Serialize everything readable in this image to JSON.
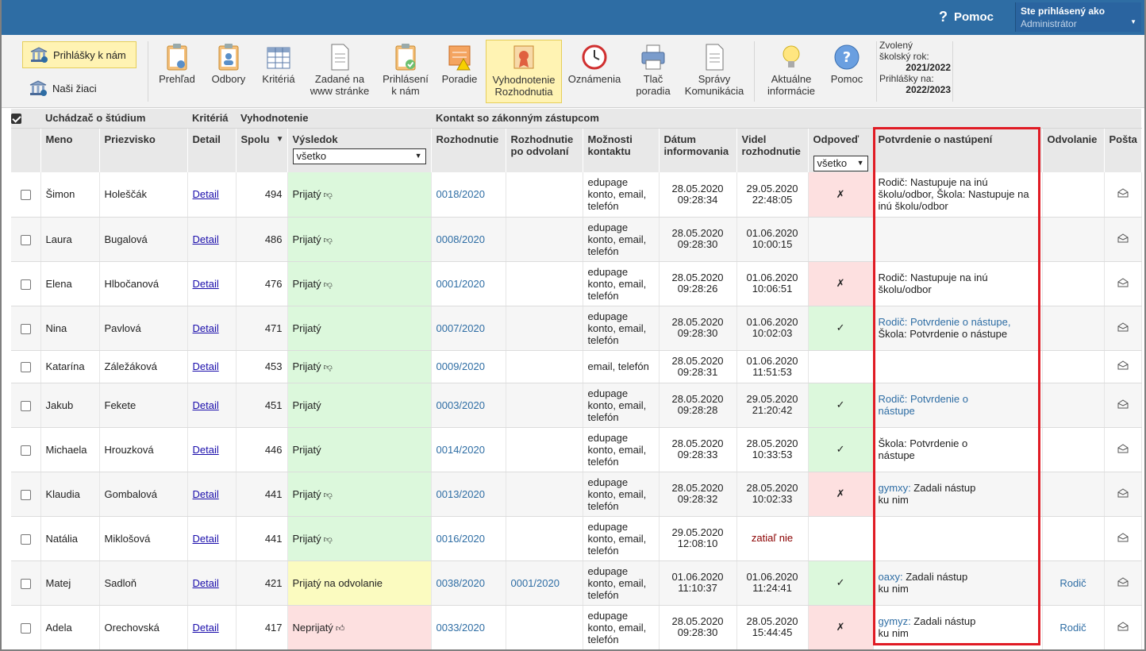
{
  "topbar": {
    "help_label": "Pomoc",
    "user_line1": "Ste prihlásený ako",
    "user_line2": "Administrátor"
  },
  "toolbar": {
    "left_buttons": [
      {
        "label": "Prihlášky k nám",
        "icon": "bank-icon"
      },
      {
        "label": "Naši žiaci",
        "icon": "bank-icon"
      }
    ],
    "buttons": [
      {
        "label": "Prehľad",
        "icon": "clipboard-eye-icon"
      },
      {
        "label": "Odbory",
        "icon": "clipboard-person-icon"
      },
      {
        "label": "Kritériá",
        "icon": "table-icon"
      },
      {
        "label": "Zadané na\nwww stránke",
        "icon": "document-icon"
      },
      {
        "label": "Prihlásení\nk nám",
        "icon": "clipboard-check-icon"
      },
      {
        "label": "Poradie",
        "icon": "warning-document-icon"
      },
      {
        "label": "Vyhodnotenie\nRozhodnutia",
        "icon": "certificate-icon"
      },
      {
        "label": "Oznámenia",
        "icon": "clock-icon"
      },
      {
        "label": "Tlač\nporadia",
        "icon": "printer-icon"
      },
      {
        "label": "Správy\nKomunikácia",
        "icon": "document-icon"
      },
      {
        "label": "Aktuálne\ninformácie",
        "icon": "lightbulb-icon"
      },
      {
        "label": "Pomoc",
        "icon": "help-circle-icon"
      }
    ],
    "year": {
      "label1": "Zvolený\nškolský rok:",
      "value1": "2021/2022",
      "label2": "Prihlášky na:",
      "value2": "2022/2023"
    }
  },
  "table": {
    "groups": {
      "student": "Uchádzač o štúdium",
      "criteria": "Kritériá",
      "evaluation": "Vyhodnotenie",
      "contact": "Kontakt so zákonným zástupcom"
    },
    "headers": {
      "first_name": "Meno",
      "last_name": "Priezvisko",
      "detail": "Detail",
      "total": "Spolu",
      "result": "Výsledok",
      "decision": "Rozhodnutie",
      "decision_appeal": "Rozhodnutie\npo odvolaní",
      "contact_options": "Možnosti\nkontaktu",
      "date_informed": "Dátum\ninformovania",
      "seen": "Videl\nrozhodnutie",
      "answer": "Odpoveď",
      "confirmation": "Potvrdenie o nastúpení",
      "appeal": "Odvolanie",
      "mail": "Pošta"
    },
    "filters": {
      "result": "všetko",
      "answer": "všetko"
    },
    "rows": [
      {
        "first": "Šimon",
        "last": "Holeščák",
        "detail": "Detail",
        "total": "494",
        "result": "Prijatý",
        "result_icon": "thumbs-down",
        "result_color": "green",
        "decision": "0018/2020",
        "decision_appeal": "",
        "contact": "edupage\nkonto, email,\ntelefón",
        "date": "28.05.2020\n09:28:34",
        "seen": "29.05.2020\n22:48:05",
        "answer": "✗",
        "answer_state": "no",
        "conf_prefix": "",
        "conf_text": "Rodič: Nastupuje na inú školu/odbor, Škola: Nastupuje na inú školu/odbor",
        "conf_blue": false,
        "appeal": ""
      },
      {
        "first": "Laura",
        "last": "Bugalová",
        "detail": "Detail",
        "total": "486",
        "result": "Prijatý",
        "result_icon": "thumbs-down",
        "result_color": "green",
        "decision": "0008/2020",
        "decision_appeal": "",
        "contact": "edupage\nkonto, email,\ntelefón",
        "date": "28.05.2020\n09:28:30",
        "seen": "01.06.2020\n10:00:15",
        "answer": "",
        "answer_state": "",
        "conf_prefix": "",
        "conf_text": "",
        "conf_blue": false,
        "appeal": ""
      },
      {
        "first": "Elena",
        "last": "Hlbočanová",
        "detail": "Detail",
        "total": "476",
        "result": "Prijatý",
        "result_icon": "thumbs-down",
        "result_color": "green",
        "decision": "0001/2020",
        "decision_appeal": "",
        "contact": "edupage\nkonto, email,\ntelefón",
        "date": "28.05.2020\n09:28:26",
        "seen": "01.06.2020\n10:06:51",
        "answer": "✗",
        "answer_state": "no",
        "conf_prefix": "",
        "conf_text": "Rodič: Nastupuje na inú\nškolu/odbor",
        "conf_blue": false,
        "appeal": ""
      },
      {
        "first": "Nina",
        "last": "Pavlová",
        "detail": "Detail",
        "total": "471",
        "result": "Prijatý",
        "result_icon": "",
        "result_color": "green",
        "decision": "0007/2020",
        "decision_appeal": "",
        "contact": "edupage\nkonto, email,\ntelefón",
        "date": "28.05.2020\n09:28:30",
        "seen": "01.06.2020\n10:02:03",
        "answer": "✓",
        "answer_state": "ok",
        "conf_prefix": "Rodič: Potvrdenie o nástupe,",
        "conf_text": "Škola: Potvrdenie o nástupe",
        "conf_blue": false,
        "appeal": ""
      },
      {
        "first": "Katarína",
        "last": "Záležáková",
        "detail": "Detail",
        "total": "453",
        "result": "Prijatý",
        "result_icon": "thumbs-down",
        "result_color": "green",
        "decision": "0009/2020",
        "decision_appeal": "",
        "contact": "email, telefón",
        "date": "28.05.2020\n09:28:31",
        "seen": "01.06.2020\n11:51:53",
        "answer": "",
        "answer_state": "",
        "conf_prefix": "",
        "conf_text": "",
        "conf_blue": false,
        "appeal": ""
      },
      {
        "first": "Jakub",
        "last": "Fekete",
        "detail": "Detail",
        "total": "451",
        "result": "Prijatý",
        "result_icon": "",
        "result_color": "green",
        "decision": "0003/2020",
        "decision_appeal": "",
        "contact": "edupage\nkonto, email,\ntelefón",
        "date": "28.05.2020\n09:28:28",
        "seen": "29.05.2020\n21:20:42",
        "answer": "✓",
        "answer_state": "ok",
        "conf_prefix": "Rodič: Potvrdenie o\nnástupe",
        "conf_text": "",
        "conf_blue": true,
        "appeal": ""
      },
      {
        "first": "Michaela",
        "last": "Hrouzková",
        "detail": "Detail",
        "total": "446",
        "result": "Prijatý",
        "result_icon": "",
        "result_color": "green",
        "decision": "0014/2020",
        "decision_appeal": "",
        "contact": "edupage\nkonto, email,\ntelefón",
        "date": "28.05.2020\n09:28:33",
        "seen": "28.05.2020\n10:33:53",
        "answer": "✓",
        "answer_state": "ok",
        "conf_prefix": "",
        "conf_text": "Škola: Potvrdenie o\nnástupe",
        "conf_blue": false,
        "appeal": ""
      },
      {
        "first": "Klaudia",
        "last": "Gombalová",
        "detail": "Detail",
        "total": "441",
        "result": "Prijatý",
        "result_icon": "thumbs-down",
        "result_color": "green",
        "decision": "0013/2020",
        "decision_appeal": "",
        "contact": "edupage\nkonto, email,\ntelefón",
        "date": "28.05.2020\n09:28:32",
        "seen": "28.05.2020\n10:02:33",
        "answer": "✗",
        "answer_state": "no",
        "conf_prefix": "gymxy:",
        "conf_text": " Zadali nástup\nku nim",
        "conf_blue": false,
        "appeal": ""
      },
      {
        "first": "Natália",
        "last": "Miklošová",
        "detail": "Detail",
        "total": "441",
        "result": "Prijatý",
        "result_icon": "thumbs-down",
        "result_color": "green",
        "decision": "0016/2020",
        "decision_appeal": "",
        "contact": "edupage\nkonto, email,\ntelefón",
        "date": "29.05.2020\n12:08:10",
        "seen": "zatiaľ nie",
        "answer": "",
        "answer_state": "",
        "conf_prefix": "",
        "conf_text": "",
        "conf_blue": false,
        "appeal": ""
      },
      {
        "first": "Matej",
        "last": "Sadloň",
        "detail": "Detail",
        "total": "421",
        "result": "Prijatý na odvolanie",
        "result_icon": "",
        "result_color": "yellow",
        "decision": "0038/2020",
        "decision_appeal": "0001/2020",
        "contact": "edupage\nkonto, email,\ntelefón",
        "date": "01.06.2020\n11:10:37",
        "seen": "01.06.2020\n11:24:41",
        "answer": "✓",
        "answer_state": "ok",
        "conf_prefix": "oaxy:",
        "conf_text": " Zadali nástup\nku nim",
        "conf_blue": false,
        "appeal": "Rodič"
      },
      {
        "first": "Adela",
        "last": "Orechovská",
        "detail": "Detail",
        "total": "417",
        "result": "Neprijatý",
        "result_icon": "thumbs-up",
        "result_color": "red",
        "decision": "0033/2020",
        "decision_appeal": "",
        "contact": "edupage\nkonto, email,\ntelefón",
        "date": "28.05.2020\n09:28:30",
        "seen": "28.05.2020\n15:44:45",
        "answer": "✗",
        "answer_state": "no",
        "conf_prefix": "gymyz:",
        "conf_text": " Zadali nástup\nku nim",
        "conf_blue": false,
        "appeal": "Rodič"
      }
    ]
  },
  "colors": {
    "topbar": "#2e6da4",
    "highlight": "#e01b24",
    "green": "#dcf8dc",
    "yellow": "#fbfbc0",
    "red": "#fde0e0"
  }
}
